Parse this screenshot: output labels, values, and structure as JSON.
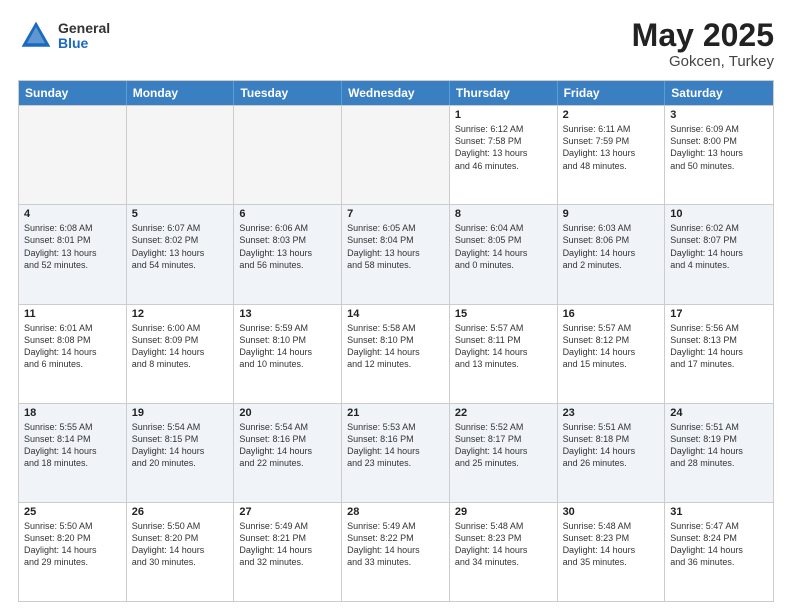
{
  "header": {
    "logo_general": "General",
    "logo_blue": "Blue",
    "month_year": "May 2025",
    "location": "Gokcen, Turkey"
  },
  "days_of_week": [
    "Sunday",
    "Monday",
    "Tuesday",
    "Wednesday",
    "Thursday",
    "Friday",
    "Saturday"
  ],
  "weeks": [
    [
      {
        "day": "",
        "empty": true,
        "lines": []
      },
      {
        "day": "",
        "empty": true,
        "lines": []
      },
      {
        "day": "",
        "empty": true,
        "lines": []
      },
      {
        "day": "",
        "empty": true,
        "lines": []
      },
      {
        "day": "1",
        "lines": [
          "Sunrise: 6:12 AM",
          "Sunset: 7:58 PM",
          "Daylight: 13 hours",
          "and 46 minutes."
        ]
      },
      {
        "day": "2",
        "lines": [
          "Sunrise: 6:11 AM",
          "Sunset: 7:59 PM",
          "Daylight: 13 hours",
          "and 48 minutes."
        ]
      },
      {
        "day": "3",
        "lines": [
          "Sunrise: 6:09 AM",
          "Sunset: 8:00 PM",
          "Daylight: 13 hours",
          "and 50 minutes."
        ]
      }
    ],
    [
      {
        "day": "4",
        "lines": [
          "Sunrise: 6:08 AM",
          "Sunset: 8:01 PM",
          "Daylight: 13 hours",
          "and 52 minutes."
        ]
      },
      {
        "day": "5",
        "lines": [
          "Sunrise: 6:07 AM",
          "Sunset: 8:02 PM",
          "Daylight: 13 hours",
          "and 54 minutes."
        ]
      },
      {
        "day": "6",
        "lines": [
          "Sunrise: 6:06 AM",
          "Sunset: 8:03 PM",
          "Daylight: 13 hours",
          "and 56 minutes."
        ]
      },
      {
        "day": "7",
        "lines": [
          "Sunrise: 6:05 AM",
          "Sunset: 8:04 PM",
          "Daylight: 13 hours",
          "and 58 minutes."
        ]
      },
      {
        "day": "8",
        "lines": [
          "Sunrise: 6:04 AM",
          "Sunset: 8:05 PM",
          "Daylight: 14 hours",
          "and 0 minutes."
        ]
      },
      {
        "day": "9",
        "lines": [
          "Sunrise: 6:03 AM",
          "Sunset: 8:06 PM",
          "Daylight: 14 hours",
          "and 2 minutes."
        ]
      },
      {
        "day": "10",
        "lines": [
          "Sunrise: 6:02 AM",
          "Sunset: 8:07 PM",
          "Daylight: 14 hours",
          "and 4 minutes."
        ]
      }
    ],
    [
      {
        "day": "11",
        "lines": [
          "Sunrise: 6:01 AM",
          "Sunset: 8:08 PM",
          "Daylight: 14 hours",
          "and 6 minutes."
        ]
      },
      {
        "day": "12",
        "lines": [
          "Sunrise: 6:00 AM",
          "Sunset: 8:09 PM",
          "Daylight: 14 hours",
          "and 8 minutes."
        ]
      },
      {
        "day": "13",
        "lines": [
          "Sunrise: 5:59 AM",
          "Sunset: 8:10 PM",
          "Daylight: 14 hours",
          "and 10 minutes."
        ]
      },
      {
        "day": "14",
        "lines": [
          "Sunrise: 5:58 AM",
          "Sunset: 8:10 PM",
          "Daylight: 14 hours",
          "and 12 minutes."
        ]
      },
      {
        "day": "15",
        "lines": [
          "Sunrise: 5:57 AM",
          "Sunset: 8:11 PM",
          "Daylight: 14 hours",
          "and 13 minutes."
        ]
      },
      {
        "day": "16",
        "lines": [
          "Sunrise: 5:57 AM",
          "Sunset: 8:12 PM",
          "Daylight: 14 hours",
          "and 15 minutes."
        ]
      },
      {
        "day": "17",
        "lines": [
          "Sunrise: 5:56 AM",
          "Sunset: 8:13 PM",
          "Daylight: 14 hours",
          "and 17 minutes."
        ]
      }
    ],
    [
      {
        "day": "18",
        "lines": [
          "Sunrise: 5:55 AM",
          "Sunset: 8:14 PM",
          "Daylight: 14 hours",
          "and 18 minutes."
        ]
      },
      {
        "day": "19",
        "lines": [
          "Sunrise: 5:54 AM",
          "Sunset: 8:15 PM",
          "Daylight: 14 hours",
          "and 20 minutes."
        ]
      },
      {
        "day": "20",
        "lines": [
          "Sunrise: 5:54 AM",
          "Sunset: 8:16 PM",
          "Daylight: 14 hours",
          "and 22 minutes."
        ]
      },
      {
        "day": "21",
        "lines": [
          "Sunrise: 5:53 AM",
          "Sunset: 8:16 PM",
          "Daylight: 14 hours",
          "and 23 minutes."
        ]
      },
      {
        "day": "22",
        "lines": [
          "Sunrise: 5:52 AM",
          "Sunset: 8:17 PM",
          "Daylight: 14 hours",
          "and 25 minutes."
        ]
      },
      {
        "day": "23",
        "lines": [
          "Sunrise: 5:51 AM",
          "Sunset: 8:18 PM",
          "Daylight: 14 hours",
          "and 26 minutes."
        ]
      },
      {
        "day": "24",
        "lines": [
          "Sunrise: 5:51 AM",
          "Sunset: 8:19 PM",
          "Daylight: 14 hours",
          "and 28 minutes."
        ]
      }
    ],
    [
      {
        "day": "25",
        "lines": [
          "Sunrise: 5:50 AM",
          "Sunset: 8:20 PM",
          "Daylight: 14 hours",
          "and 29 minutes."
        ]
      },
      {
        "day": "26",
        "lines": [
          "Sunrise: 5:50 AM",
          "Sunset: 8:20 PM",
          "Daylight: 14 hours",
          "and 30 minutes."
        ]
      },
      {
        "day": "27",
        "lines": [
          "Sunrise: 5:49 AM",
          "Sunset: 8:21 PM",
          "Daylight: 14 hours",
          "and 32 minutes."
        ]
      },
      {
        "day": "28",
        "lines": [
          "Sunrise: 5:49 AM",
          "Sunset: 8:22 PM",
          "Daylight: 14 hours",
          "and 33 minutes."
        ]
      },
      {
        "day": "29",
        "lines": [
          "Sunrise: 5:48 AM",
          "Sunset: 8:23 PM",
          "Daylight: 14 hours",
          "and 34 minutes."
        ]
      },
      {
        "day": "30",
        "lines": [
          "Sunrise: 5:48 AM",
          "Sunset: 8:23 PM",
          "Daylight: 14 hours",
          "and 35 minutes."
        ]
      },
      {
        "day": "31",
        "lines": [
          "Sunrise: 5:47 AM",
          "Sunset: 8:24 PM",
          "Daylight: 14 hours",
          "and 36 minutes."
        ]
      }
    ]
  ]
}
